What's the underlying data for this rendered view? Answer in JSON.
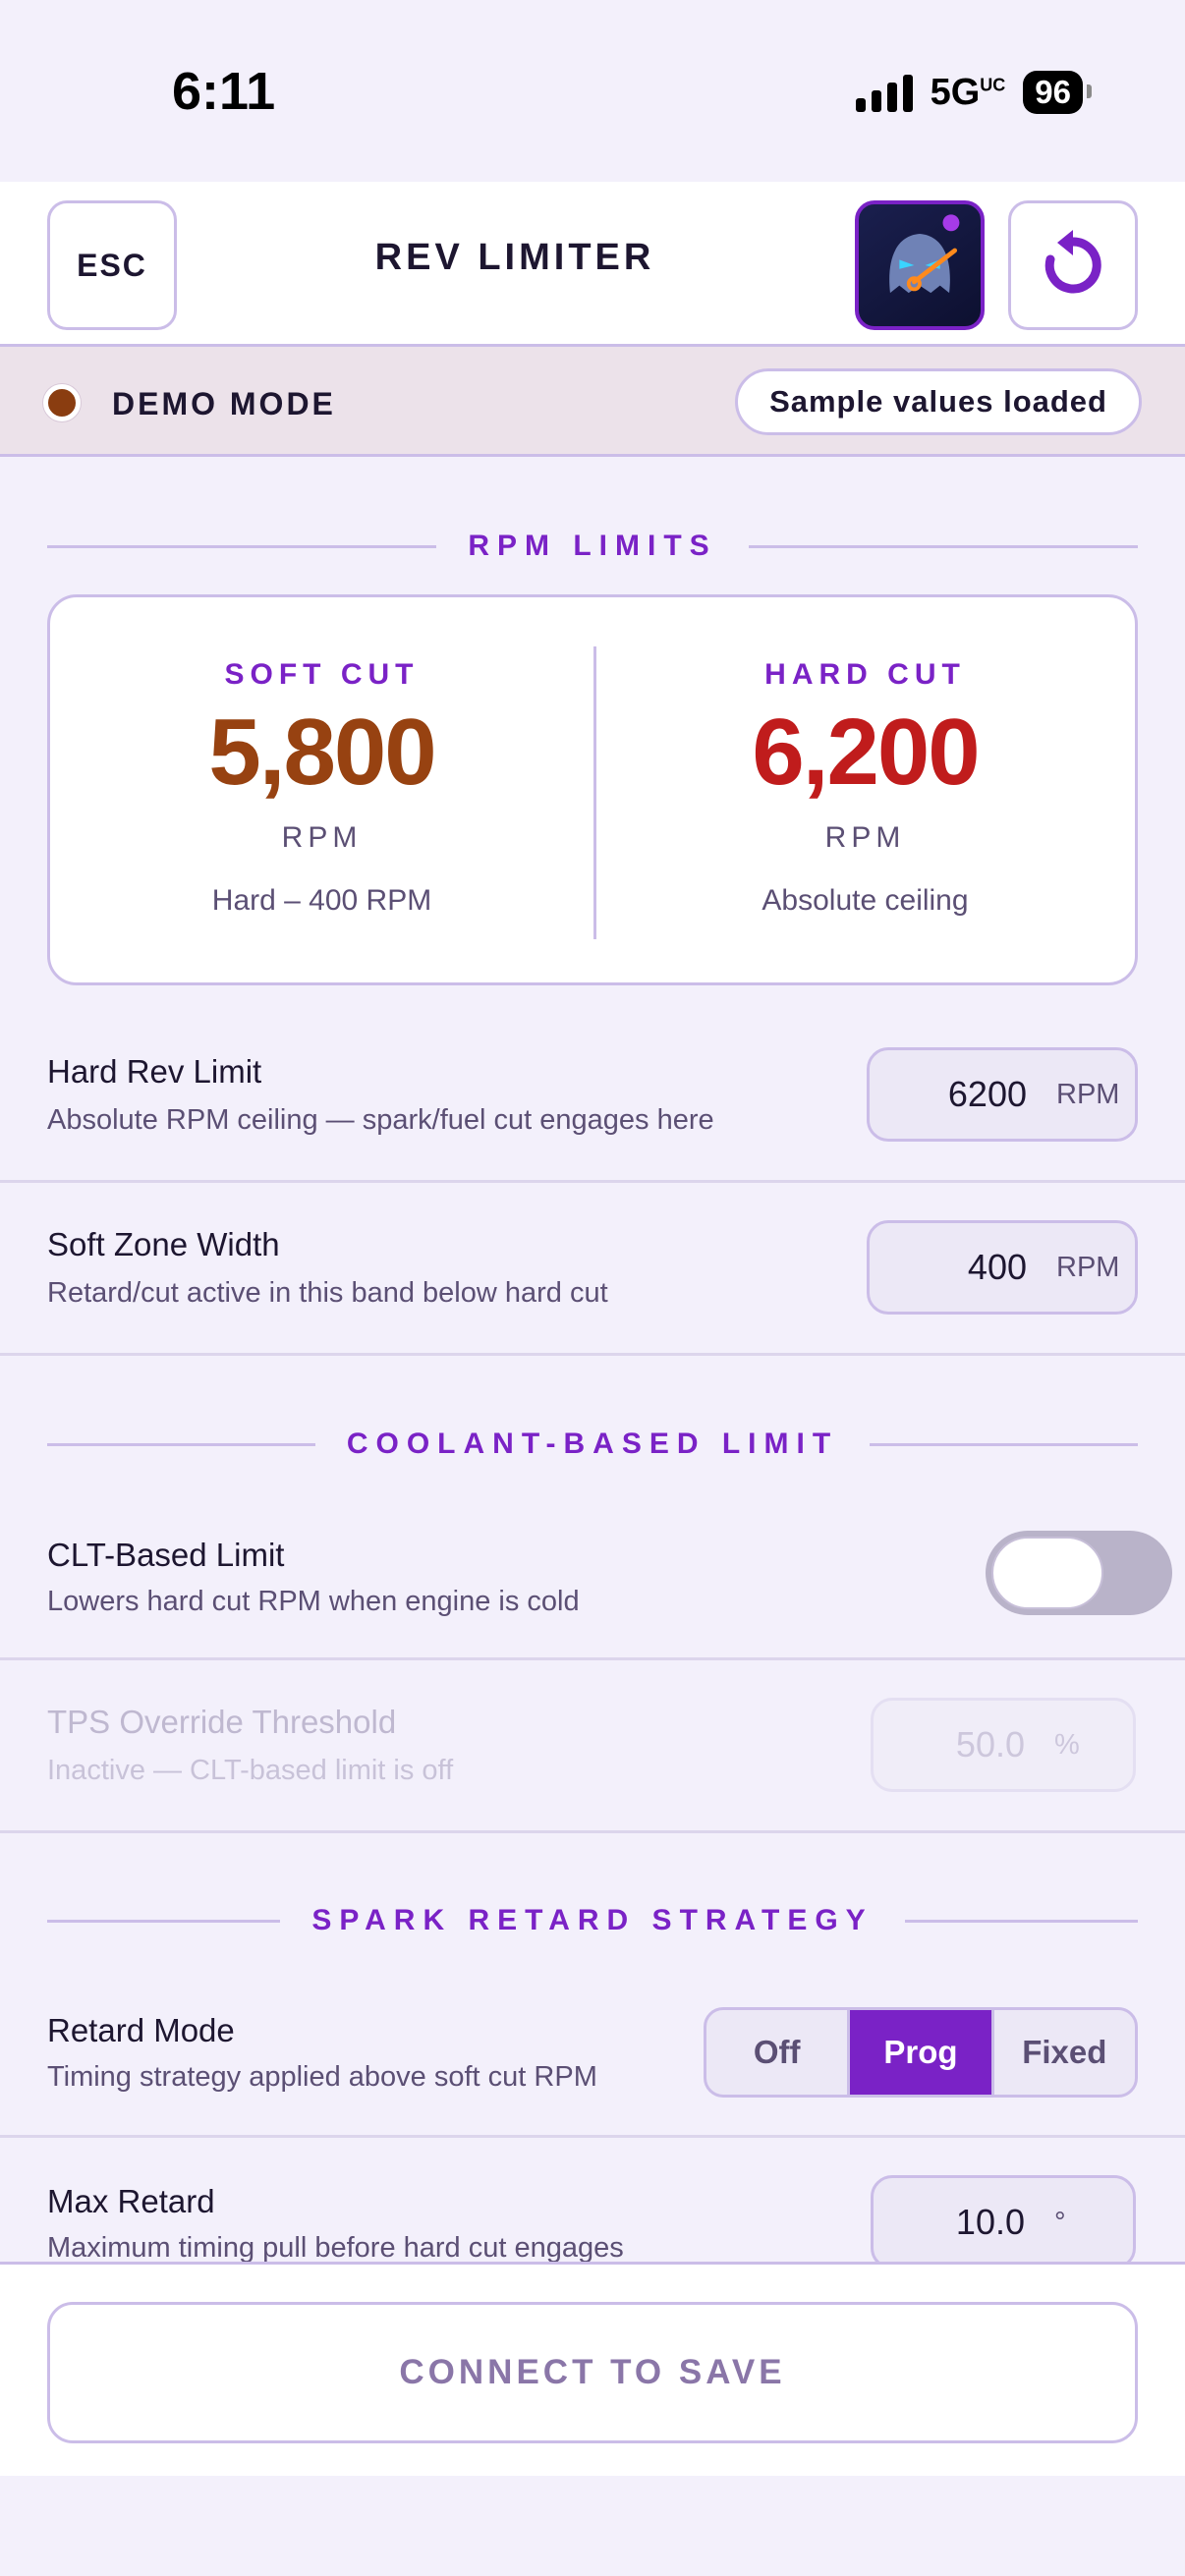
{
  "status_bar": {
    "time": "6:11",
    "network": "5G",
    "network_suffix": "UC",
    "battery": "96"
  },
  "header": {
    "esc_label": "ESC",
    "title": "REV LIMITER"
  },
  "demo": {
    "label": "DEMO MODE",
    "badge": "Sample values loaded"
  },
  "rpm_limits": {
    "section_title": "RPM LIMITS",
    "soft": {
      "label": "SOFT CUT",
      "value": "5,800",
      "unit": "RPM",
      "note": "Hard – 400 RPM"
    },
    "hard": {
      "label": "HARD CUT",
      "value": "6,200",
      "unit": "RPM",
      "note": "Absolute ceiling"
    }
  },
  "hard_rev_limit": {
    "title": "Hard Rev Limit",
    "desc": "Absolute RPM ceiling — spark/fuel cut engages here",
    "value": "6200",
    "unit": "RPM"
  },
  "soft_zone_width": {
    "title": "Soft Zone Width",
    "desc": "Retard/cut active in this band below hard cut",
    "value": "400",
    "unit": "RPM"
  },
  "coolant": {
    "section_title": "COOLANT-BASED LIMIT",
    "clt_limit": {
      "title": "CLT-Based Limit",
      "desc": "Lowers hard cut RPM when engine is cold",
      "enabled": false
    },
    "tps_override": {
      "title": "TPS Override Threshold",
      "desc": "Inactive — CLT-based limit is off",
      "value": "50.0",
      "unit": "%"
    }
  },
  "spark": {
    "section_title": "SPARK RETARD STRATEGY",
    "retard_mode": {
      "title": "Retard Mode",
      "desc": "Timing strategy applied above soft cut RPM",
      "options": [
        "Off",
        "Prog",
        "Fixed"
      ],
      "selected": "Prog"
    },
    "max_retard": {
      "title": "Max Retard",
      "desc": "Maximum timing pull before hard cut engages",
      "value": "10.0",
      "unit": "°"
    }
  },
  "footer": {
    "save_label": "CONNECT TO SAVE"
  },
  "colors": {
    "accent": "#7a22c6",
    "soft_value": "#974211",
    "hard_value": "#c01c1c",
    "demo_dot": "#8a3d10"
  }
}
